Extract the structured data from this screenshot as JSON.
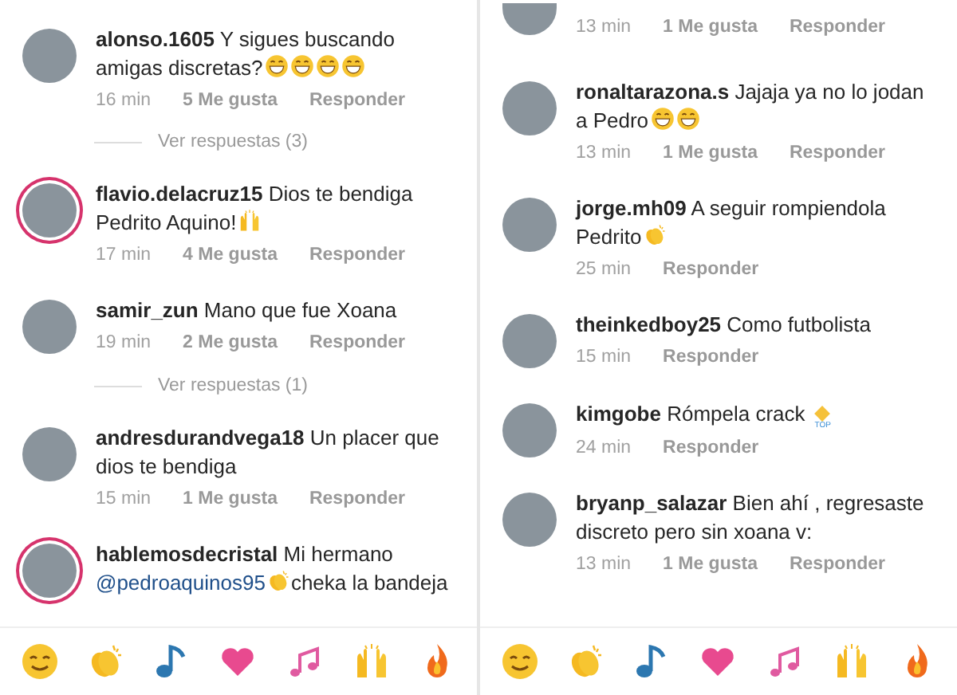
{
  "columns": [
    {
      "items": [
        {
          "kind": "comment",
          "user": "alonso.1605",
          "text": "Y sigues buscando amigas discretas?",
          "emoji": [
            {
              "kind": "grin"
            },
            {
              "kind": "grin"
            },
            {
              "kind": "grin"
            },
            {
              "kind": "grin"
            }
          ],
          "time": "16 min",
          "likes": "5 Me gusta",
          "reply": "Responder",
          "story": false
        },
        {
          "kind": "replies",
          "label": "Ver respuestas (3)"
        },
        {
          "kind": "comment",
          "user": "flavio.delacruz15",
          "text": "Dios te bendiga Pedrito Aquino!",
          "emoji": [
            {
              "kind": "hands"
            }
          ],
          "time": "17 min",
          "likes": "4 Me gusta",
          "reply": "Responder",
          "story": true
        },
        {
          "kind": "comment",
          "user": "samir_zun",
          "text": "Mano que fue Xoana",
          "time": "19 min",
          "likes": "2 Me gusta",
          "reply": "Responder",
          "story": false
        },
        {
          "kind": "replies",
          "label": "Ver respuestas (1)"
        },
        {
          "kind": "comment",
          "user": "andresdurandvega18",
          "text": "Un placer que dios te bendiga",
          "time": "15 min",
          "likes": "1 Me gusta",
          "reply": "Responder",
          "story": false
        },
        {
          "kind": "comment",
          "user": "hablemosdecristal",
          "text": "Mi hermano",
          "mention": "@pedroaquinos95",
          "emoji": [
            {
              "kind": "clap"
            }
          ],
          "text2": "cheka la bandeja",
          "story": true
        }
      ],
      "emoji_bar": [
        {
          "kind": "smile"
        },
        {
          "kind": "clap"
        },
        {
          "kind": "note"
        },
        {
          "kind": "heart"
        },
        {
          "kind": "notes"
        },
        {
          "kind": "hands"
        },
        {
          "kind": "fire"
        }
      ]
    },
    {
      "items": [
        {
          "kind": "meta",
          "time": "13 min",
          "likes": "1 Me gusta",
          "reply": "Responder"
        },
        {
          "kind": "comment",
          "user": "ronaltarazona.s",
          "text": "Jajaja ya no lo jodan a Pedro",
          "emoji": [
            {
              "kind": "grin"
            },
            {
              "kind": "grin"
            }
          ],
          "time": "13 min",
          "likes": "1 Me gusta",
          "reply": "Responder",
          "story": false
        },
        {
          "kind": "comment",
          "user": "jorge.mh09",
          "text": "A seguir rompiendola Pedrito",
          "emoji": [
            {
              "kind": "clap"
            }
          ],
          "time": "25 min",
          "reply": "Responder",
          "story": false
        },
        {
          "kind": "comment",
          "user": "theinkedboy25",
          "text": "Como futbolista",
          "time": "15 min",
          "reply": "Responder",
          "story": false
        },
        {
          "kind": "comment",
          "user": "kimgobe",
          "text": "Rómpela crack",
          "badge": "TOP",
          "time": "24 min",
          "reply": "Responder",
          "story": false
        },
        {
          "kind": "comment",
          "user": "bryanp_salazar",
          "text": "Bien ahí , regresaste discreto pero sin xoana v:",
          "time": "13 min",
          "likes": "1 Me gusta",
          "reply": "Responder",
          "story": false
        }
      ],
      "emoji_bar": [
        {
          "kind": "smile"
        },
        {
          "kind": "clap"
        },
        {
          "kind": "note"
        },
        {
          "kind": "heart"
        },
        {
          "kind": "notes"
        },
        {
          "kind": "hands"
        },
        {
          "kind": "fire"
        }
      ]
    }
  ]
}
